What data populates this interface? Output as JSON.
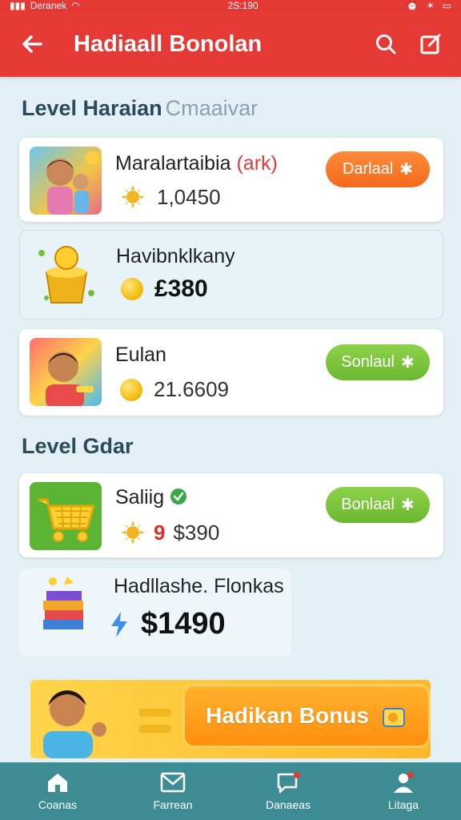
{
  "status_bar": {
    "carrier": "Deranek",
    "time": "2S:190"
  },
  "header": {
    "title": "Hadiaall Bonolan"
  },
  "sections": [
    {
      "title": "Level Haraian",
      "subtitle": "Cmaaivar"
    },
    {
      "title": "Level Gdar"
    }
  ],
  "cards": [
    {
      "title": "Maralartaibia",
      "title_accent": "(ark)",
      "amount": "1,0450",
      "button": "Darlaal"
    },
    {
      "title": "Havibnklkany",
      "amount": "£380"
    },
    {
      "title": "Eulan",
      "amount": "21.6609",
      "button": "Sonlaul"
    },
    {
      "title": "Saliig",
      "amount": "$390",
      "amount_prefix": "9",
      "button": "Bonlaal"
    },
    {
      "title": "Hadllashe. Flonkas",
      "amount": "$1490"
    }
  ],
  "banner": {
    "label": "Hadikan Bonus"
  },
  "bottom_nav": [
    {
      "label": "Coanas",
      "icon": "home-icon"
    },
    {
      "label": "Farrean",
      "icon": "mail-icon"
    },
    {
      "label": "Danaeas",
      "icon": "chat-icon"
    },
    {
      "label": "Litaga",
      "icon": "profile-icon"
    }
  ],
  "colors": {
    "primary": "#e53935",
    "background": "#e3f0f6",
    "orange_button": "#f47522",
    "green_button": "#76c03a",
    "nav": "#3e8c93"
  }
}
